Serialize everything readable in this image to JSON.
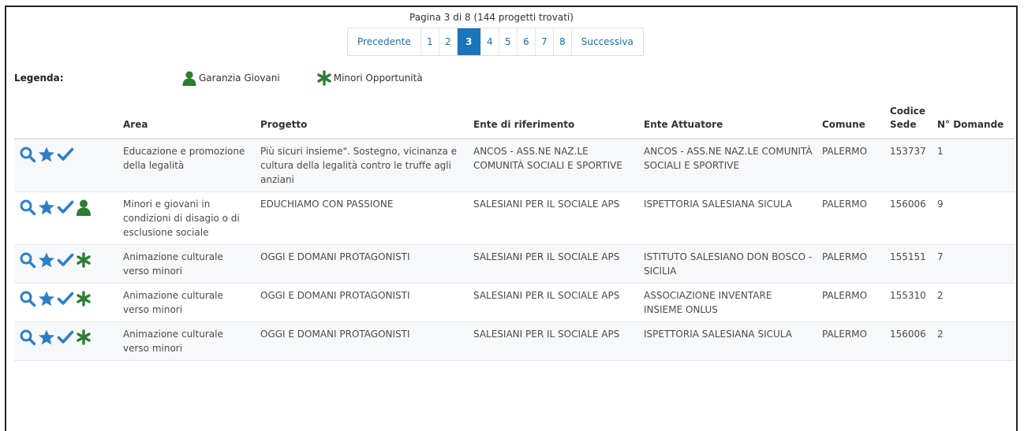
{
  "pagination": {
    "info": "Pagina 3 di 8 (144 progetti trovati)",
    "prev": "Precedente",
    "next": "Successiva",
    "pages": [
      "1",
      "2",
      "3",
      "4",
      "5",
      "6",
      "7",
      "8"
    ],
    "current": "3"
  },
  "legend": {
    "label": "Legenda:",
    "items": [
      {
        "icon": "person-icon",
        "label": "Garanzia Giovani",
        "color": "#2e7d32"
      },
      {
        "icon": "asterisk-icon",
        "label": "Minori Opportunità",
        "color": "#2e7d32"
      }
    ]
  },
  "colors": {
    "accent": "#1c74bd",
    "icon_blue": "#2f7fc6",
    "icon_green": "#2e7d32"
  },
  "table": {
    "headers": {
      "area": "Area",
      "progetto": "Progetto",
      "ente_rif": "Ente di riferimento",
      "ente_att": "Ente Attuatore",
      "comune": "Comune",
      "codice_sede": "Codice Sede",
      "n_domande": "N° Domande"
    },
    "rows": [
      {
        "badge": "",
        "area": "Educazione e promozione della legalità",
        "progetto": "Più sicuri insieme\". Sostegno, vicinanza e cultura della legalità contro le truffe agli anziani",
        "ente_rif": "ANCOS - ASS.NE NAZ.LE COMUNITÀ SOCIALI E SPORTIVE",
        "ente_att": "ANCOS - ASS.NE NAZ.LE COMUNITÀ SOCIALI E SPORTIVE",
        "comune": "PALERMO",
        "codice_sede": "153737",
        "n_domande": "1"
      },
      {
        "badge": "person-icon",
        "area": "Minori e giovani in condizioni di disagio o di esclusione sociale",
        "progetto": "EDUCHIAMO CON PASSIONE",
        "ente_rif": "SALESIANI PER IL SOCIALE APS",
        "ente_att": "ISPETTORIA SALESIANA SICULA",
        "comune": "PALERMO",
        "codice_sede": "156006",
        "n_domande": "9"
      },
      {
        "badge": "asterisk-icon",
        "area": "Animazione culturale verso minori",
        "progetto": "OGGI E DOMANI PROTAGONISTI",
        "ente_rif": "SALESIANI PER IL SOCIALE APS",
        "ente_att": "ISTITUTO SALESIANO DON BOSCO - SICILIA",
        "comune": "PALERMO",
        "codice_sede": "155151",
        "n_domande": "7"
      },
      {
        "badge": "asterisk-icon",
        "area": "Animazione culturale verso minori",
        "progetto": "OGGI E DOMANI PROTAGONISTI",
        "ente_rif": "SALESIANI PER IL SOCIALE APS",
        "ente_att": "ASSOCIAZIONE INVENTARE INSIEME ONLUS",
        "comune": "PALERMO",
        "codice_sede": "155310",
        "n_domande": "2"
      },
      {
        "badge": "asterisk-icon",
        "area": "Animazione culturale verso minori",
        "progetto": "OGGI E DOMANI PROTAGONISTI",
        "ente_rif": "SALESIANI PER IL SOCIALE APS",
        "ente_att": "ISPETTORIA SALESIANA SICULA",
        "comune": "PALERMO",
        "codice_sede": "156006",
        "n_domande": "2"
      }
    ]
  }
}
